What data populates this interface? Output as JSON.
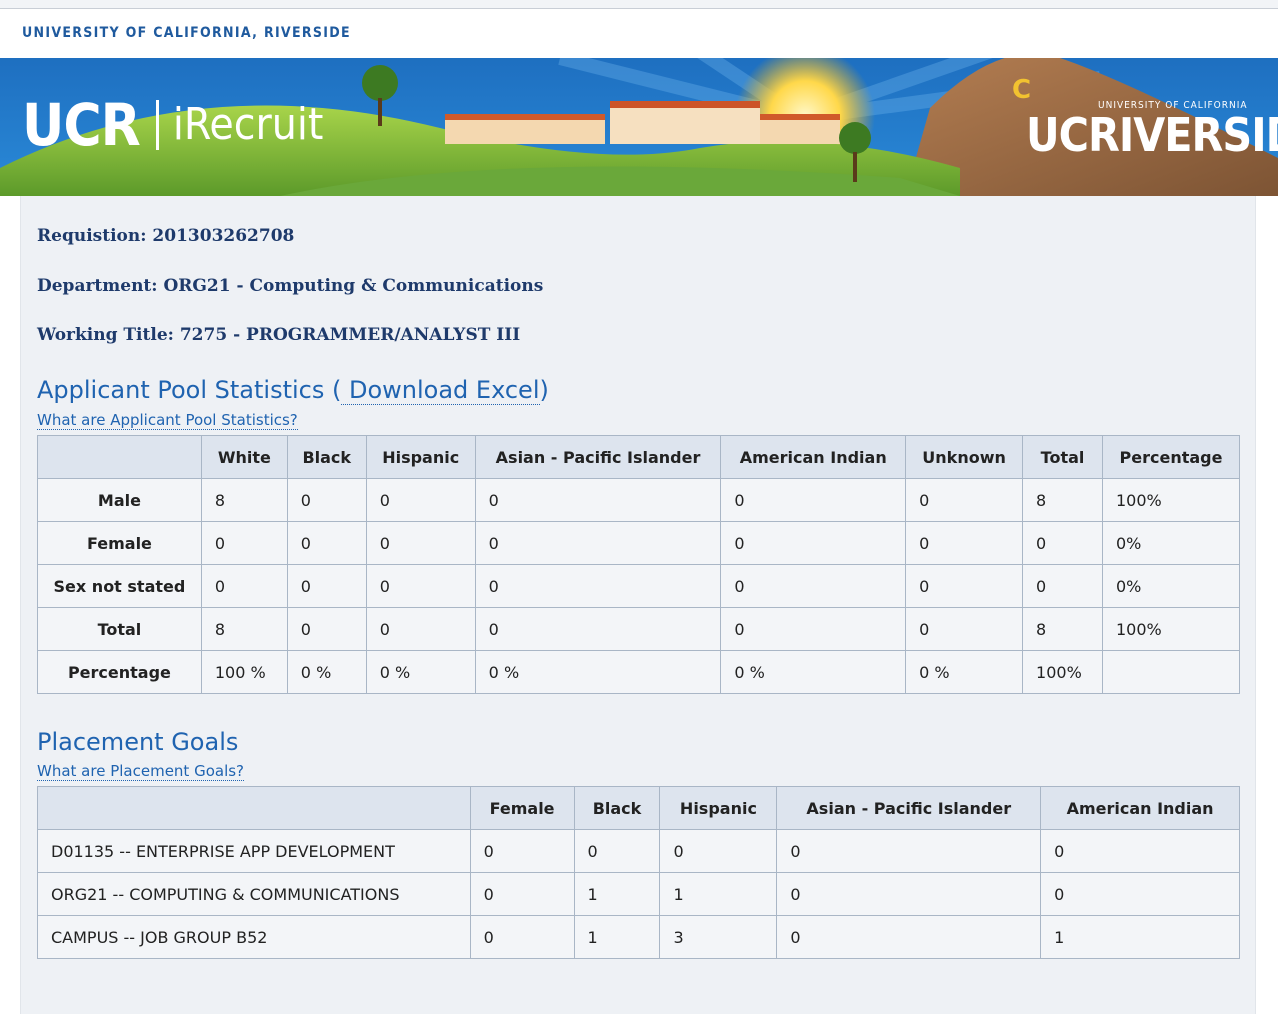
{
  "header": {
    "university_name": "UNIVERSITY OF CALIFORNIA, RIVERSIDE",
    "brand_ucr": "UCR",
    "brand_app": "iRecruit",
    "logo_small": "UNIVERSITY OF CALIFORNIA",
    "logo_big": "UCRIVERSIDE"
  },
  "requisition": {
    "requisition": "Requistion: 201303262708",
    "department": "Department: ORG21 - Computing & Communications",
    "working_title": "Working Title: 7275 - PROGRAMMER/ANALYST III"
  },
  "applicant_pool": {
    "title_prefix": "Applicant Pool Statistics (",
    "download_link": " Download Excel",
    "title_suffix": ")",
    "help_link": "What are Applicant Pool Statistics?",
    "headers": [
      "",
      "White",
      "Black",
      "Hispanic",
      "Asian - Pacific Islander",
      "American Indian",
      "Unknown",
      "Total",
      "Percentage"
    ],
    "rows": [
      [
        "Male",
        "8",
        "0",
        "0",
        "0",
        "0",
        "0",
        "8",
        "100%"
      ],
      [
        "Female",
        "0",
        "0",
        "0",
        "0",
        "0",
        "0",
        "0",
        "0%"
      ],
      [
        "Sex not stated",
        "0",
        "0",
        "0",
        "0",
        "0",
        "0",
        "0",
        "0%"
      ],
      [
        "Total",
        "8",
        "0",
        "0",
        "0",
        "0",
        "0",
        "8",
        "100%"
      ],
      [
        "Percentage",
        "100 %",
        "0 %",
        "0 %",
        "0 %",
        "0 %",
        "0 %",
        "100%",
        ""
      ]
    ]
  },
  "placement_goals": {
    "title": "Placement Goals",
    "help_link": "What are Placement Goals?",
    "headers": [
      "",
      "Female",
      "Black",
      "Hispanic",
      "Asian - Pacific Islander",
      "American Indian"
    ],
    "rows": [
      [
        "D01135 -- ENTERPRISE APP DEVELOPMENT",
        "0",
        "0",
        "0",
        "0",
        "0"
      ],
      [
        "ORG21 -- COMPUTING & COMMUNICATIONS",
        "0",
        "1",
        "1",
        "0",
        "0"
      ],
      [
        "CAMPUS -- JOB GROUP B52",
        "0",
        "1",
        "3",
        "0",
        "1"
      ]
    ]
  }
}
